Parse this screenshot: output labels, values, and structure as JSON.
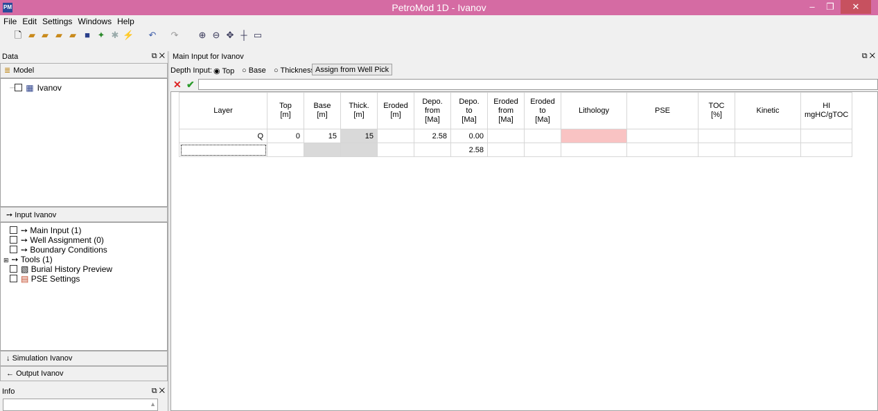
{
  "window": {
    "title": "PetroMod 1D - Ivanov",
    "app_icon": "PM"
  },
  "menu": [
    "File",
    "Edit",
    "Settings",
    "Windows",
    "Help"
  ],
  "toolbar_icons": [
    "new-icon",
    "open-icon",
    "open-folder-icon",
    "open-folder-2-icon",
    "open-folder-3-icon",
    "save-icon",
    "run-icon",
    "person-icon",
    "stats-icon",
    "undo-icon",
    "redo-icon",
    "zoom-in-icon",
    "zoom-out-icon",
    "pan-icon",
    "crosshair-icon",
    "rectangle-icon"
  ],
  "data_panel": {
    "title": "Data",
    "model_label": "Model",
    "tree": [
      {
        "label": "Ivanov"
      }
    ]
  },
  "input_panel": {
    "title": "Input Ivanov",
    "tree": [
      {
        "label": "Main Input (1)",
        "icon": "arrow-right-icon"
      },
      {
        "label": "Well Assignment (0)",
        "icon": "arrow-right-icon"
      },
      {
        "label": "Boundary Conditions",
        "icon": "arrow-right-icon"
      },
      {
        "label": "Tools (1)",
        "icon": "arrow-right-icon"
      },
      {
        "label": "Burial History Preview",
        "icon": "chart-icon"
      },
      {
        "label": "PSE Settings",
        "icon": "pse-icon"
      }
    ]
  },
  "simulation_label": "Simulation Ivanov",
  "output_label": "Output Ivanov",
  "info_panel": {
    "title": "Info"
  },
  "main": {
    "title": "Main Input for Ivanov",
    "depth_input_label": "Depth Input:",
    "radio_options": [
      "Top",
      "Base",
      "Thickness"
    ],
    "selected_option": "Top",
    "assign_button": "Assign from Well Pick",
    "columns": [
      [
        "Layer"
      ],
      [
        "Top",
        "[m]"
      ],
      [
        "Base",
        "[m]"
      ],
      [
        "Thick.",
        "[m]"
      ],
      [
        "Eroded",
        "[m]"
      ],
      [
        "Depo.",
        "from",
        "[Ma]"
      ],
      [
        "Depo.",
        "to",
        "[Ma]"
      ],
      [
        "Eroded",
        "from",
        "[Ma]"
      ],
      [
        "Eroded",
        "to",
        "[Ma]"
      ],
      [
        "Lithology"
      ],
      [
        "PSE"
      ],
      [
        "TOC",
        "[%]"
      ],
      [
        "Kinetic"
      ],
      [
        "HI",
        "mgHC/gTOC"
      ]
    ],
    "rows": [
      [
        "Q",
        "0",
        "15",
        "15",
        "",
        "2.58",
        "0.00",
        "",
        "",
        "",
        "",
        "",
        "",
        ""
      ],
      [
        "",
        "",
        "",
        "",
        "",
        "",
        "2.58",
        "",
        "",
        "",
        "",
        "",
        "",
        ""
      ]
    ]
  }
}
